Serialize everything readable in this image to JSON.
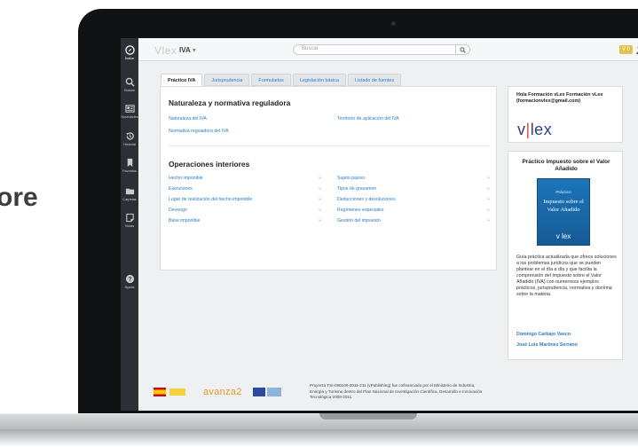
{
  "edge_text": "ore",
  "app": {
    "brand": "Vlex",
    "section": "IVA",
    "search_placeholder": "Buscar",
    "badge": "V 0"
  },
  "sidebar": {
    "items": [
      {
        "label": "Índice",
        "icon": "compass-icon"
      },
      {
        "label": "Buscar",
        "icon": "search-icon"
      },
      {
        "label": "Novedades",
        "icon": "news-icon"
      },
      {
        "label": "Historial",
        "icon": "history-icon"
      },
      {
        "label": "Favoritos",
        "icon": "bookmark-icon"
      },
      {
        "label": "Carpetas",
        "icon": "folder-icon"
      },
      {
        "label": "Notas",
        "icon": "note-icon"
      },
      {
        "label": "Ayuda",
        "icon": "help-icon"
      }
    ]
  },
  "tabs": [
    "Práctico IVA",
    "Jurisprudencia",
    "Formularios",
    "Legislación básica",
    "Listado de fuentes"
  ],
  "sections": {
    "naturaleza": {
      "title": "Naturaleza y normativa reguladora",
      "links": [
        "Naturaleza del IVA",
        "Normativa reguladora del IVA",
        "Territorio de aplicación del IVA"
      ]
    },
    "operaciones": {
      "title": "Operaciones interiores",
      "left": [
        "Hecho imponible",
        "Exenciones",
        "Lugar de realización del hecho imponible",
        "Devengo",
        "Base imponible"
      ],
      "right": [
        "Sujeto pasivo",
        "Tipos de gravamen",
        "Deducciones y devoluciones",
        "Regímenes especiales",
        "Gestión del impuesto"
      ],
      "chevron": "»"
    }
  },
  "greeting": {
    "text": "Hola Formación vLex Formación vLex (formacionvlex@gmail.com)",
    "logo_left": "v",
    "logo_bar": "|",
    "logo_right": "lex"
  },
  "book": {
    "title": "Práctico Impuesto sobre el Valor Añadido",
    "cover_small": "Práctico",
    "cover_big": "Impuesto sobre el Valor Añadido",
    "cover_logo": "v lex",
    "description": "Guía práctica actualizada que ofrece soluciones a los problemas jurídicos que se pueden plantear en el día a día y que facilita la comprensión del Impuesto sobre el Valor Añadido (IVA) con numerosos ejemplos prácticos, jurisprudencia, normativa y doctrina sobre la materia.",
    "authors": [
      "Domingo Carbajo Vasco",
      "José Luis Martínez Serrano"
    ]
  },
  "footer": {
    "avanza": "avanza2",
    "text": "Proyecto TSI-090100-2011-211 (vPublishing) fue cofinanciado por el Ministerio de Industria, Energía y Turismo dentro del Plan Nacional de Investigación Científica, Desarrollo e Innovación Tecnológica 2008-2011."
  },
  "colors": {
    "accent": "#2c7bc8",
    "sidebar": "#2c2f33",
    "brand_blue": "#2f3e8f",
    "brand_red": "#e9473f"
  }
}
